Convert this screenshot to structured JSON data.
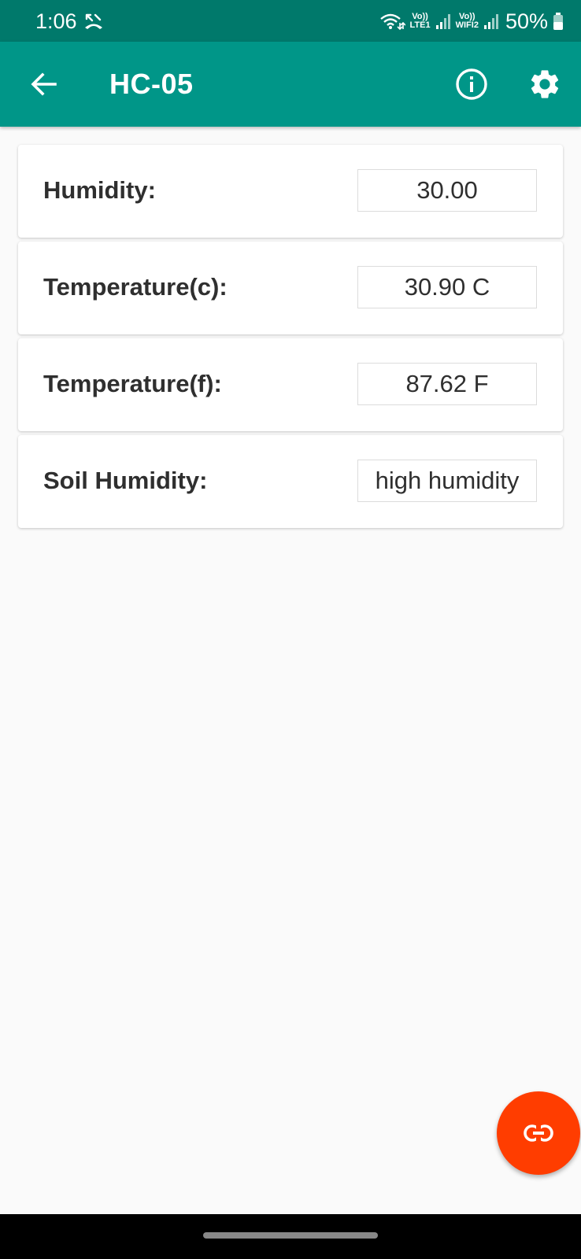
{
  "status_bar": {
    "time": "1:06",
    "network1_line1": "Vo))",
    "network1_line2": "LTE1",
    "network2_line1": "Vo))",
    "network2_line2": "WIFI2",
    "battery": "50%"
  },
  "app_bar": {
    "title": "HC-05",
    "icons": [
      "arrow-back-icon",
      "info-icon",
      "settings-icon"
    ]
  },
  "readings": [
    {
      "label": "Humidity:",
      "value": "30.00"
    },
    {
      "label": "Temperature(c):",
      "value": "30.90 C"
    },
    {
      "label": "Temperature(f):",
      "value": "87.62 F"
    },
    {
      "label": "Soil Humidity:",
      "value": "high humidity"
    }
  ],
  "fab": {
    "icon": "link-icon"
  },
  "colors": {
    "status_bar": "#00796b",
    "app_bar": "#009688",
    "fab": "#ff3d00",
    "background": "#fafafa"
  }
}
